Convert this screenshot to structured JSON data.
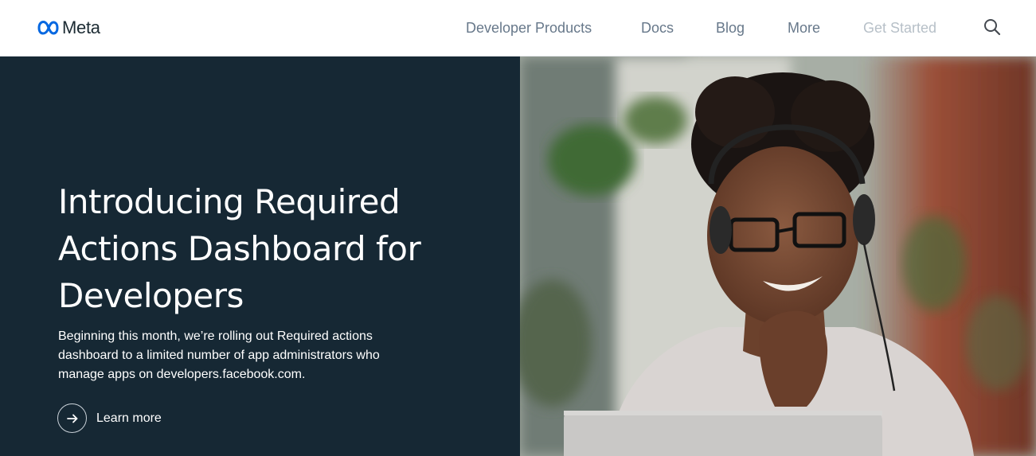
{
  "brand": {
    "name": "Meta"
  },
  "nav": {
    "items": [
      {
        "label": "Developer Products"
      },
      {
        "label": "Docs"
      },
      {
        "label": "Blog"
      },
      {
        "label": "More"
      },
      {
        "label": "Get Started"
      }
    ],
    "search_icon": "search-icon"
  },
  "hero": {
    "title": "Introducing Required Actions Dashboard for Developers",
    "description": "Beginning this month, we’re rolling out Required actions dashboard to a limited number of app administrators who manage apps on developers.facebook.com.",
    "cta": {
      "label": "Learn more",
      "icon": "arrow-right-icon"
    },
    "background_color": "#162834",
    "image_subject": "woman-with-headset-photo"
  },
  "colors": {
    "nav_text": "#67788a",
    "nav_muted": "#b7c0c8",
    "brand_blue": "#0668E1"
  }
}
